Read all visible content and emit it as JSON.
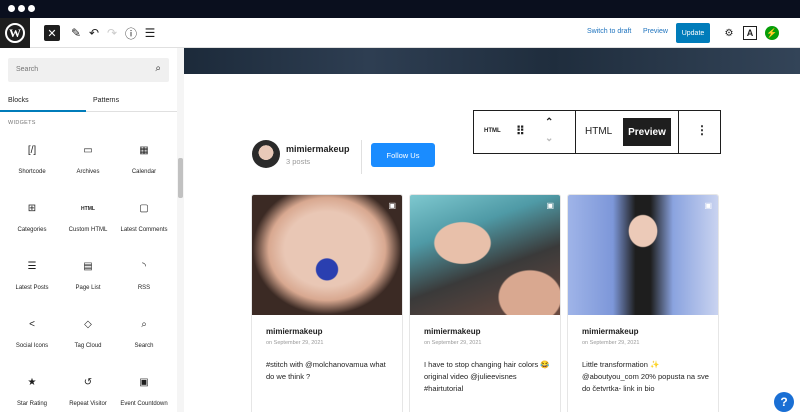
{
  "topbar": {
    "switch_to_draft": "Switch to draft",
    "preview": "Preview",
    "update": "Update"
  },
  "sidebar": {
    "search_placeholder": "Search",
    "tabs": [
      "Blocks",
      "Patterns"
    ],
    "section_title": "WIDGETS",
    "blocks": [
      {
        "label": "Shortcode",
        "icon": "[/]"
      },
      {
        "label": "Archives",
        "icon": "▭"
      },
      {
        "label": "Calendar",
        "icon": "▦"
      },
      {
        "label": "Categories",
        "icon": "⊞"
      },
      {
        "label": "Custom HTML",
        "icon": "HTML"
      },
      {
        "label": "Latest Comments",
        "icon": "▢"
      },
      {
        "label": "Latest Posts",
        "icon": "☰"
      },
      {
        "label": "Page List",
        "icon": "▤"
      },
      {
        "label": "RSS",
        "icon": "◝"
      },
      {
        "label": "Social Icons",
        "icon": "<"
      },
      {
        "label": "Tag Cloud",
        "icon": "◇"
      },
      {
        "label": "Search",
        "icon": "⌕"
      },
      {
        "label": "Star Rating",
        "icon": "★"
      },
      {
        "label": "Repeat Visitor",
        "icon": "↺"
      },
      {
        "label": "Event Countdown",
        "icon": "▣"
      }
    ]
  },
  "block_toolbar": {
    "html_icon": "HTML",
    "html_label": "HTML",
    "preview_label": "Preview"
  },
  "profile": {
    "username": "mimiermakeup",
    "posts": "3 posts",
    "follow": "Follow Us"
  },
  "posts": [
    {
      "username": "mimiermakeup",
      "date": "on September 29, 2021",
      "caption": "#stitch with @molchanovamua what do we think ?"
    },
    {
      "username": "mimiermakeup",
      "date": "on September 29, 2021",
      "caption": "I have to stop changing hair colors 😂 original video @julieevisnes #hairtutorial"
    },
    {
      "username": "mimiermakeup",
      "date": "on September 29, 2021",
      "caption": "Little transformation ✨ @aboutyou_com 20% popusta na sve do četvrtka- link in bio"
    }
  ],
  "help": "?"
}
